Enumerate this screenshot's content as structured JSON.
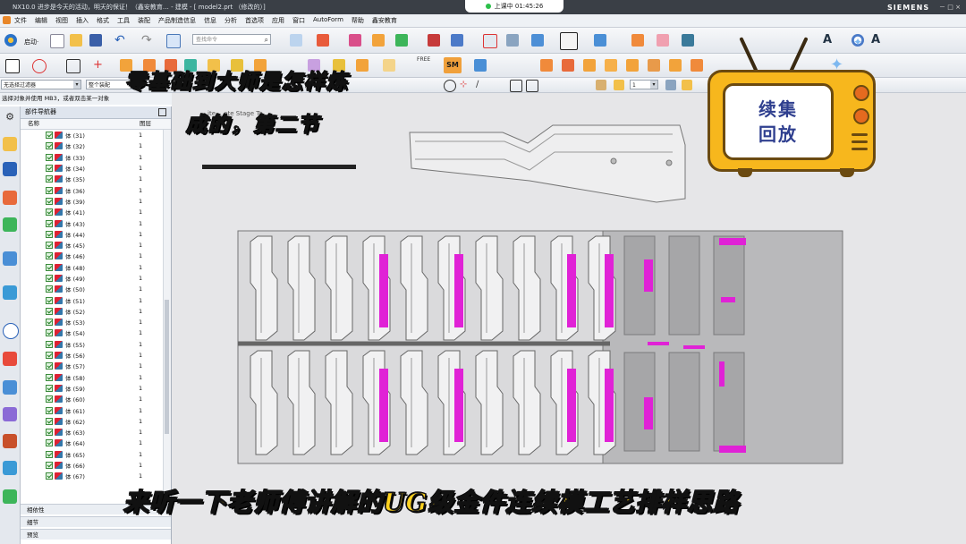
{
  "window": {
    "title": "NX10.0 进步是今天的活动，明天的保证！（鑫安教育… - 建模 - [ model2.prt （修改的）]",
    "recording": "上课中 01:45:26",
    "brand": "SIEMENS",
    "controls": "－ □ ×"
  },
  "menu": {
    "items": [
      "文件",
      "编辑",
      "视图",
      "插入",
      "格式",
      "工具",
      "装配",
      "产品制造信息",
      "信息",
      "分析",
      "首选项",
      "应用",
      "窗口",
      "AutoForm",
      "帮助",
      "鑫安教育"
    ]
  },
  "toolbar": {
    "start_label": "启动·",
    "command_search_placeholder": "查找命令",
    "filter_select": "无选择过滤器",
    "assembly_select": "整个装配",
    "layer_value": "1",
    "sm_label": "SM",
    "free_label": "FREE"
  },
  "hint": "选择对象并使用 MB3，或者双击某一对象",
  "navigator": {
    "title": "部件导航器",
    "col_name": "名称",
    "col_layer": "图层",
    "rows": [
      {
        "name": "体 (31)",
        "layer": "1"
      },
      {
        "name": "体 (32)",
        "layer": "1"
      },
      {
        "name": "体 (33)",
        "layer": "1"
      },
      {
        "name": "体 (34)",
        "layer": "1"
      },
      {
        "name": "体 (35)",
        "layer": "1"
      },
      {
        "name": "体 (36)",
        "layer": "1"
      },
      {
        "name": "体 (39)",
        "layer": "1"
      },
      {
        "name": "体 (41)",
        "layer": "1"
      },
      {
        "name": "体 (43)",
        "layer": "1"
      },
      {
        "name": "体 (44)",
        "layer": "1"
      },
      {
        "name": "体 (45)",
        "layer": "1"
      },
      {
        "name": "体 (46)",
        "layer": "1"
      },
      {
        "name": "体 (48)",
        "layer": "1"
      },
      {
        "name": "体 (49)",
        "layer": "1"
      },
      {
        "name": "体 (50)",
        "layer": "1"
      },
      {
        "name": "体 (51)",
        "layer": "1"
      },
      {
        "name": "体 (52)",
        "layer": "1"
      },
      {
        "name": "体 (53)",
        "layer": "1"
      },
      {
        "name": "体 (54)",
        "layer": "1"
      },
      {
        "name": "体 (55)",
        "layer": "1"
      },
      {
        "name": "体 (56)",
        "layer": "1"
      },
      {
        "name": "体 (57)",
        "layer": "1"
      },
      {
        "name": "体 (58)",
        "layer": "1"
      },
      {
        "name": "体 (59)",
        "layer": "1"
      },
      {
        "name": "体 (60)",
        "layer": "1"
      },
      {
        "name": "体 (61)",
        "layer": "1"
      },
      {
        "name": "体 (62)",
        "layer": "1"
      },
      {
        "name": "体 (63)",
        "layer": "1"
      },
      {
        "name": "体 (64)",
        "layer": "1"
      },
      {
        "name": "体 (65)",
        "layer": "1"
      },
      {
        "name": "体 (66)",
        "layer": "1"
      },
      {
        "name": "体 (67)",
        "layer": "1"
      }
    ],
    "sections": [
      "相依性",
      "细节",
      "预览"
    ]
  },
  "graphics": {
    "stage_label": "ite… ate Stage To…"
  },
  "overlay": {
    "line1": "零基础到大师是怎样炼",
    "line2": "成的，第二节",
    "caption": "来听一下老师傅讲解的UG级金件连续模工艺排样思路",
    "badge_line1": "续集",
    "badge_line2": "回放"
  },
  "colors": {
    "highlight": "#e022d6",
    "part_gray": "#a9a9ab",
    "part_outline": "#6f6f72",
    "badge_yellow": "#f7b71d"
  }
}
